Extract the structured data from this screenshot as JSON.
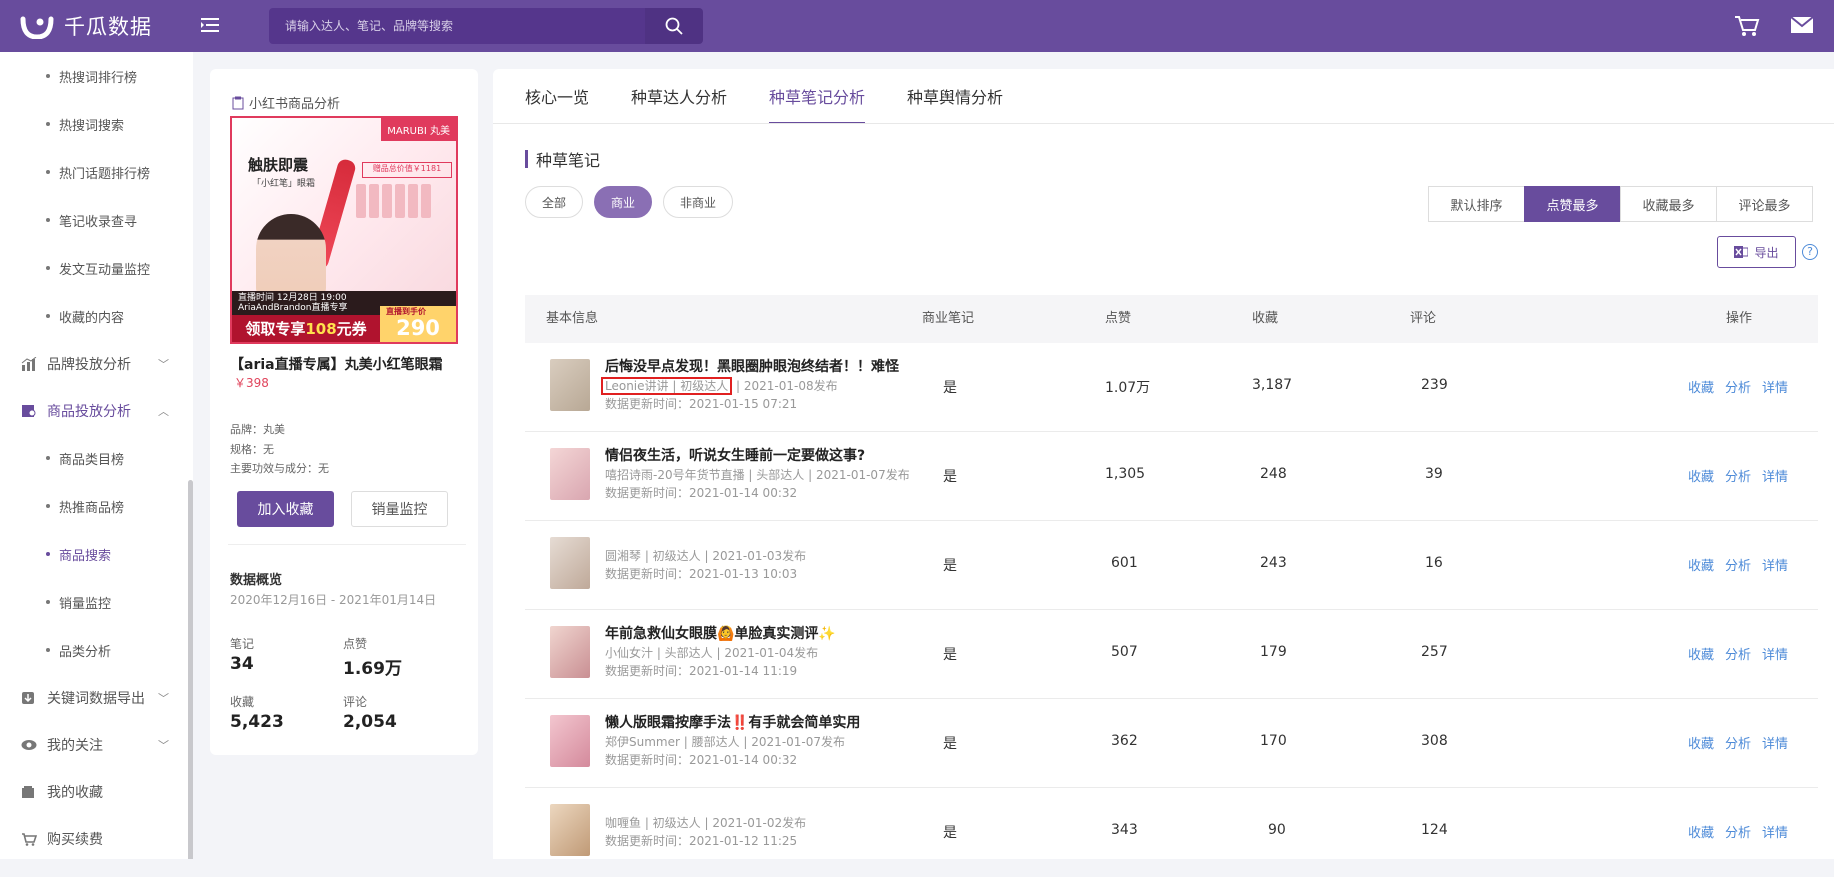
{
  "topbar": {
    "logo_text": "千瓜数据",
    "search_placeholder": "请输入达人、笔记、品牌等搜索",
    "icons": [
      "menu-toggle-icon",
      "search-icon",
      "cart-icon",
      "mail-icon"
    ]
  },
  "sidebar": {
    "top_items": [
      "热搜词排行榜",
      "热搜词搜索",
      "热门话题排行榜",
      "笔记收录查寻",
      "发文互动量监控",
      "收藏的内容"
    ],
    "groups": [
      {
        "label": "品牌投放分析",
        "icon": "bar-chart-icon",
        "expanded": false
      },
      {
        "label": "商品投放分析",
        "icon": "product-search-icon",
        "expanded": true
      }
    ],
    "product_items": [
      "商品类目榜",
      "热推商品榜",
      "商品搜索",
      "销量监控",
      "品类分析"
    ],
    "active_item": "商品搜索",
    "bottom_groups": [
      {
        "label": "关键词数据导出",
        "icon": "download-icon"
      },
      {
        "label": "我的关注",
        "icon": "eye-icon"
      },
      {
        "label": "我的收藏",
        "icon": "folder-icon"
      },
      {
        "label": "购买续费",
        "icon": "cart-icon"
      }
    ]
  },
  "product": {
    "header": "小红书商品分析",
    "image": {
      "brand": "MARUBI 丸美",
      "headline": "触肤即震",
      "sub": "「小红笔」眼霜",
      "gift": "赠品总价值￥1181",
      "live_strip": "直播时间 12月28日 19:00",
      "live_strip2": "AriaAndBrandon直播专享",
      "coupon_pre": "领取专享",
      "coupon_amount": "108",
      "coupon_post": "元券",
      "price_tag": "直播到手价",
      "price": "290"
    },
    "title": "【aria直播专属】丸美小红笔眼霜",
    "price": "￥398",
    "brand": "品牌：丸美",
    "spec": "规格：无",
    "ingredients": "主要功效与成分：无",
    "btn_favorite": "加入收藏",
    "btn_monitor": "销量监控",
    "overview": {
      "title": "数据概览",
      "range": "2020年12月16日 - 2021年01月14日",
      "notes_label": "笔记",
      "notes_value": "34",
      "likes_label": "点赞",
      "likes_value": "1.69万",
      "collect_label": "收藏",
      "collect_value": "5,423",
      "comment_label": "评论",
      "comment_value": "2,054"
    }
  },
  "main": {
    "tabs": [
      "核心一览",
      "种草达人分析",
      "种草笔记分析",
      "种草舆情分析"
    ],
    "active_tab": "种草笔记分析",
    "section_title": "种草笔记",
    "filters": [
      "全部",
      "商业",
      "非商业"
    ],
    "active_filter": "商业",
    "sorts": [
      "默认排序",
      "点赞最多",
      "收藏最多",
      "评论最多"
    ],
    "active_sort": "点赞最多",
    "export_label": "导出",
    "help_label": "?",
    "columns": [
      "基本信息",
      "商业笔记",
      "点赞",
      "收藏",
      "评论",
      "操作"
    ],
    "ops": [
      "收藏",
      "分析",
      "详情"
    ],
    "rows": [
      {
        "title": "后悔没早点发现！黑眼圈肿眼泡终结者！！难怪",
        "author": "Leonie讲讲 | 初级达人",
        "date": "| 2021-01-08发布",
        "update": "数据更新时间：2021-01-15 07:21",
        "commercial": "是",
        "likes": "1.07万",
        "collects": "3,187",
        "comments": "239",
        "thumb": "#c9b9a6"
      },
      {
        "title": "情侣夜生活，听说女生睡前一定要做这事?",
        "author": "嘻招诗雨-20号年货节直播 | 头部达人",
        "date": "| 2021-01-07发布",
        "update": "数据更新时间：2021-01-14 00:32",
        "commercial": "是",
        "likes": "1,305",
        "collects": "248",
        "comments": "39",
        "thumb": "#e7b8b8"
      },
      {
        "title": "",
        "author": "圆湘琴 | 初级达人",
        "date": "| 2021-01-03发布",
        "update": "数据更新时间：2021-01-13 10:03",
        "commercial": "是",
        "likes": "601",
        "collects": "243",
        "comments": "16",
        "thumb": "#d8c6b8"
      },
      {
        "title": "年前急救仙女眼膜🙆单脸真实测评✨",
        "author": "小仙女汁 | 头部达人",
        "date": "| 2021-01-04发布",
        "update": "数据更新时间：2021-01-14 11:19",
        "commercial": "是",
        "likes": "507",
        "collects": "179",
        "comments": "257",
        "thumb": "#e9c7c4"
      },
      {
        "title": "懒人版眼霜按摩手法‼️有手就会简单实用",
        "author": "郑伊Summer | 腰部达人",
        "date": "| 2021-01-07发布",
        "update": "数据更新时间：2021-01-14 00:32",
        "commercial": "是",
        "likes": "362",
        "collects": "170",
        "comments": "308",
        "thumb": "#dca3ad"
      },
      {
        "title": "",
        "author": "咖喱鱼 | 初级达人",
        "date": "| 2021-01-02发布",
        "update": "数据更新时间：2021-01-12 11:25",
        "commercial": "是",
        "likes": "343",
        "collects": "90",
        "comments": "124",
        "thumb": "#d9b896"
      }
    ]
  },
  "colors": {
    "brand": "#684c9d",
    "link": "#4e8bd8",
    "price": "#e0445c"
  }
}
